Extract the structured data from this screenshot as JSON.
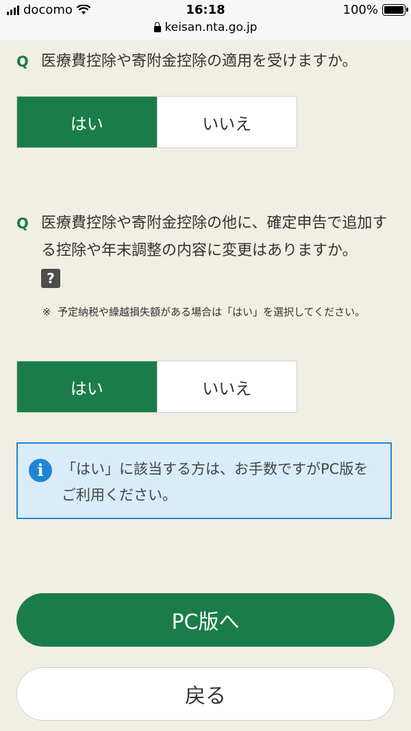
{
  "status_bar": {
    "carrier": "docomo",
    "time": "16:18",
    "battery": "100%",
    "url": "keisan.nta.go.jp",
    "icons": [
      "signal-icon",
      "wifi-icon",
      "battery-icon",
      "lock-icon"
    ]
  },
  "question1": {
    "mark": "Q",
    "text": "医療費控除や寄附金控除の適用を受けますか。",
    "options": {
      "yes": "はい",
      "no": "いいえ"
    },
    "selected": "yes"
  },
  "question2": {
    "mark": "Q",
    "text": "医療費控除や寄附金控除の他に、確定申告で追加する控除や年末調整の内容に変更はありますか。",
    "help": "?",
    "note_mark": "※",
    "note": "予定納税や繰越損失額がある場合は「はい」を選択してください。",
    "options": {
      "yes": "はい",
      "no": "いいえ"
    },
    "selected": "yes"
  },
  "info": {
    "icon": "i",
    "text": "「はい」に該当する方は、お手数ですがPC版をご利用ください。"
  },
  "buttons": {
    "pc": "PC版へ",
    "back": "戻る"
  },
  "colors": {
    "accent_green": "#1a7d49",
    "info_blue": "#1f86d6",
    "info_bg": "#d8ecfa",
    "page_bg": "#f1eee3"
  }
}
